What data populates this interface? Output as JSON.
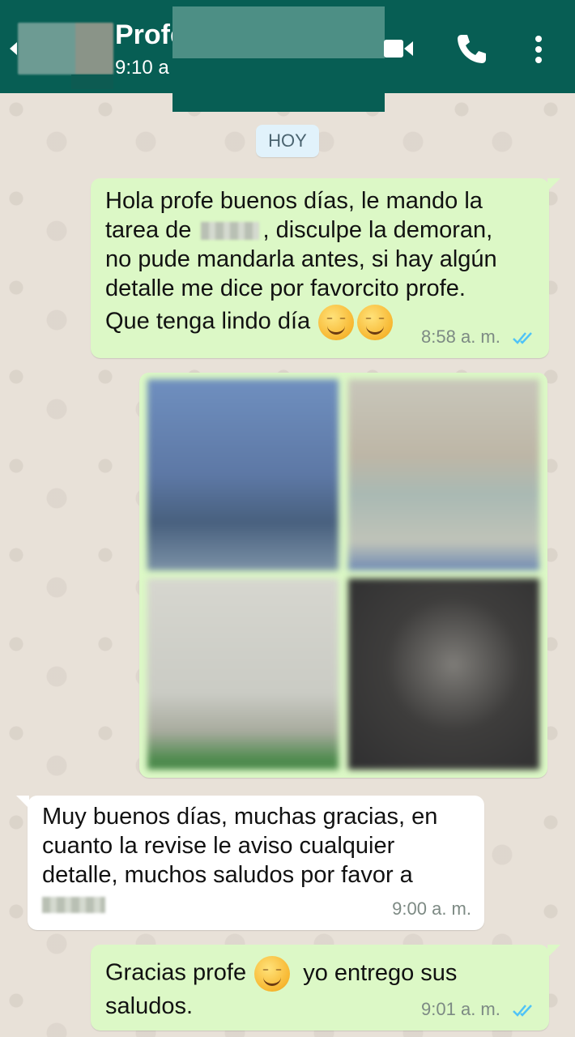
{
  "header": {
    "contact_name": "Profe",
    "last_seen": "9:10 a",
    "video_icon": "video-call-icon",
    "call_icon": "phone-icon",
    "menu_icon": "more-vert-icon",
    "color": "#075e54"
  },
  "chat": {
    "date_chip": "HOY",
    "messages": [
      {
        "direction": "outgoing",
        "text_line1": "Hola profe buenos días, le mando la",
        "text_line2_pre": "tarea de",
        "text_line2_post": ", disculpe la demoran,",
        "text_line3": "no pude mandarla antes, si hay algún",
        "text_line4": "detalle me dice por favorcito profe.",
        "text_line5": "Que tenga lindo día",
        "time": "8:58 a. m.",
        "status": "read"
      },
      {
        "direction": "outgoing",
        "type": "image-album",
        "image_count": 4
      },
      {
        "direction": "incoming",
        "text_line1": "Muy buenos días, muchas gracias, en",
        "text_line2": "cuanto la revise le aviso cualquier",
        "text_line3": "detalle, muchos saludos por favor a",
        "time": "9:00 a. m."
      },
      {
        "direction": "outgoing",
        "text_line1_pre": "Gracias profe",
        "text_line1_post": "yo entrego sus",
        "text_line2": "saludos.",
        "time": "9:01 a. m.",
        "status": "read"
      }
    ]
  },
  "colors": {
    "outgoing_bubble": "#dcf8c6",
    "incoming_bubble": "#ffffff",
    "read_ticks": "#4fc3f7"
  }
}
